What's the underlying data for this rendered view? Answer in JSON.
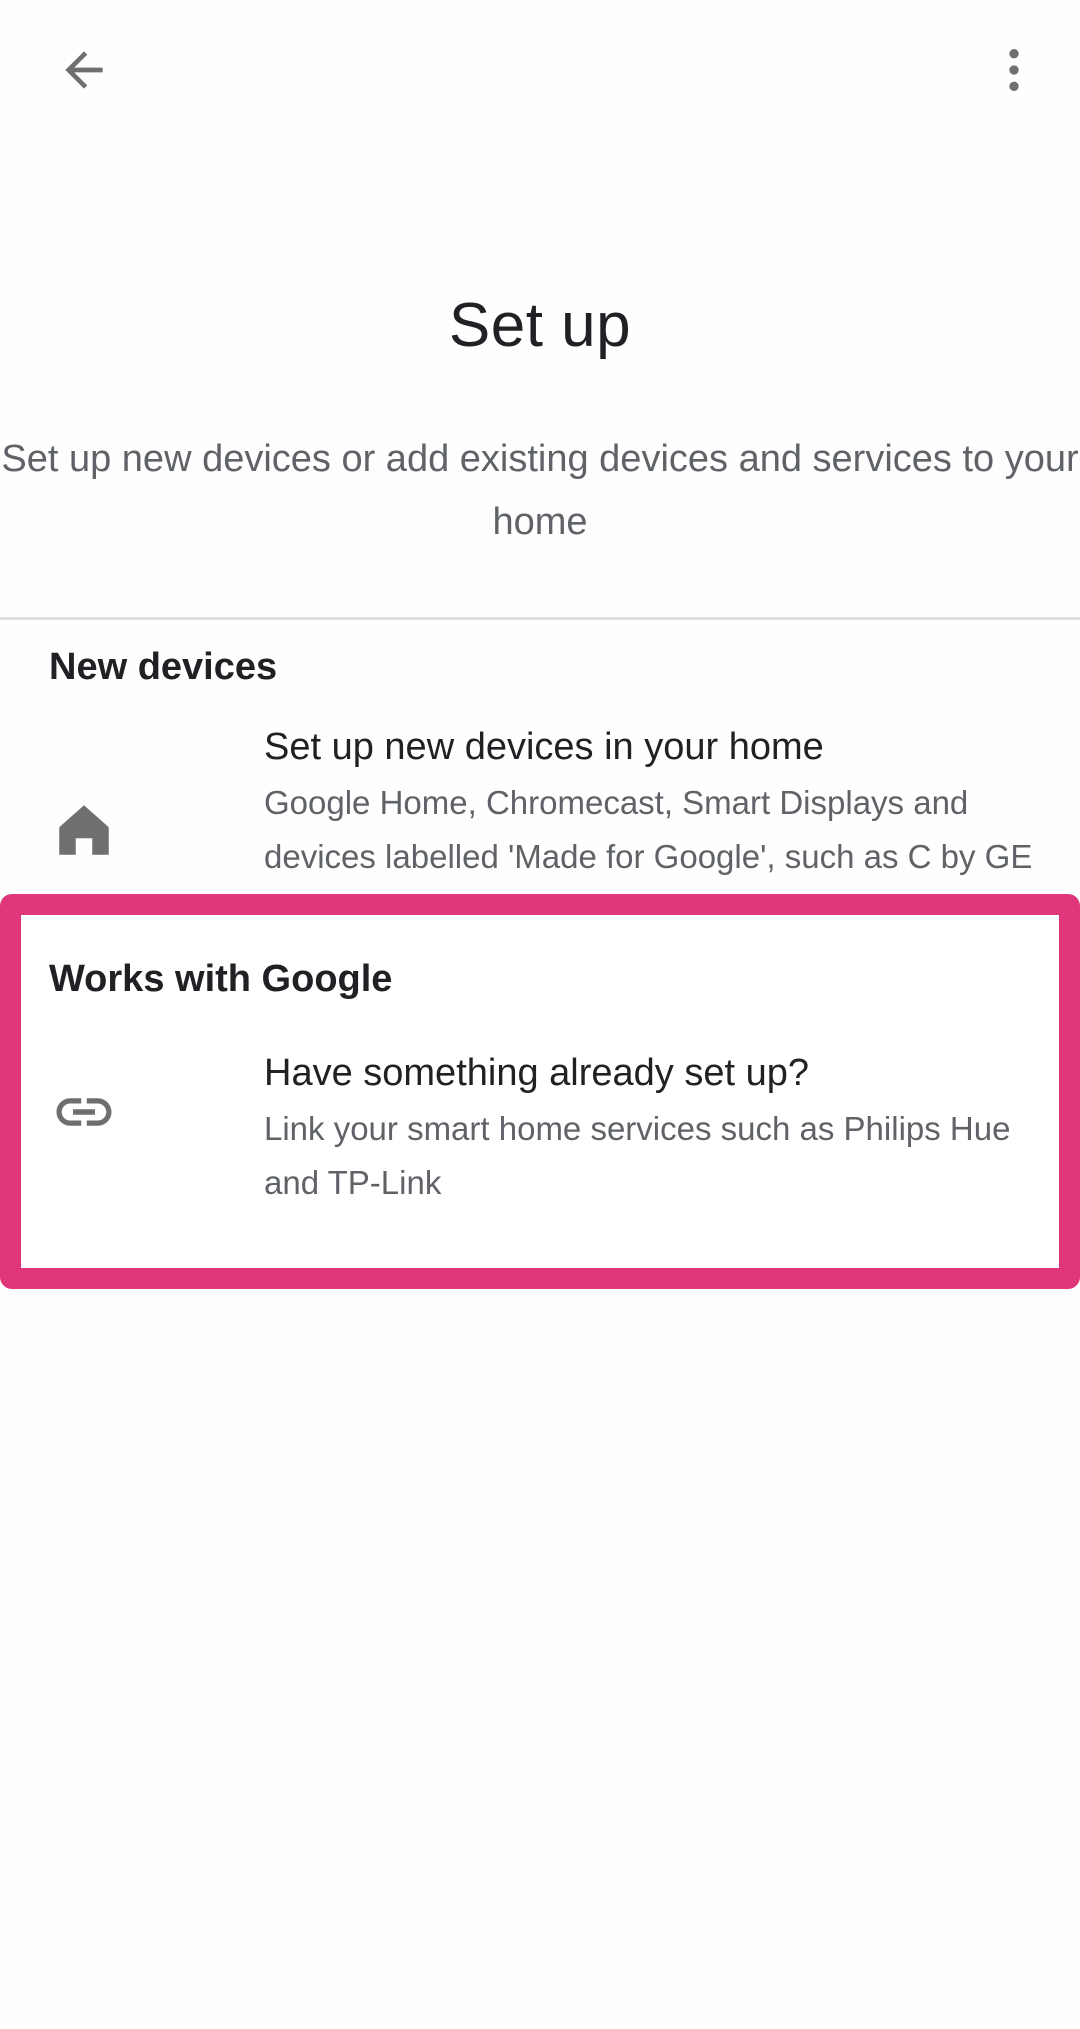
{
  "top_bar": {
    "back_icon": "arrow-back-icon",
    "more_icon": "more-vert-icon"
  },
  "header": {
    "title": "Set up",
    "subtitle": "Set up new devices or add existing devices and services to your home"
  },
  "sections": {
    "new_devices": {
      "header": "New devices",
      "item": {
        "icon": "home-icon",
        "title": "Set up new devices in your home",
        "description": "Google Home, Chromecast, Smart Displays and devices labelled 'Made for Google', such as C by GE smart bulbs"
      }
    },
    "works_with_google": {
      "header": "Works with Google",
      "item": {
        "icon": "link-icon",
        "title": "Have something already set up?",
        "description": "Link your smart home services such as Philips Hue and TP-Link"
      }
    }
  },
  "colors": {
    "highlight_border": "#e0367a",
    "icon_gray": "#6f6f6f",
    "secondary_text": "#5f6368",
    "primary_text": "#202124"
  }
}
